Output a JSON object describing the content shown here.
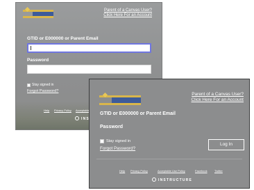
{
  "back_screen": {
    "header_link_line1": "Parent of a Canvas User?",
    "header_link_line2": "Click Here For an Account",
    "username_label": "GTID or E000000 or Parent Email",
    "username_value": "",
    "password_label": "Password",
    "password_value": "",
    "stay_signed_in": "Stay signed in",
    "forgot_password": "Forgot Password?",
    "footer_links": [
      "Help",
      "Privacy Policy",
      "Acceptable"
    ],
    "brand": "INSTRUCT"
  },
  "front_screen": {
    "header_link_line1": "Parent of a Canvas User?",
    "header_link_line2": "Click Here For an Account",
    "username_label": "GTID or E000000 or Parent Email",
    "password_label": "Password",
    "stay_signed_in": "Stay signed in",
    "forgot_password": "Forgot Password?",
    "login_button": "Log In",
    "footer_links": [
      "Help",
      "Privacy Policy",
      "Acceptable Use Policy",
      "Facebook",
      "Twitter"
    ],
    "brand": "INSTRUCTURE"
  },
  "colors": {
    "panel_gray": "#8c8d8e",
    "logo_gold": "#d9b64b",
    "logo_blue": "#3d5b9a",
    "focus_border": "#6f76e0"
  }
}
